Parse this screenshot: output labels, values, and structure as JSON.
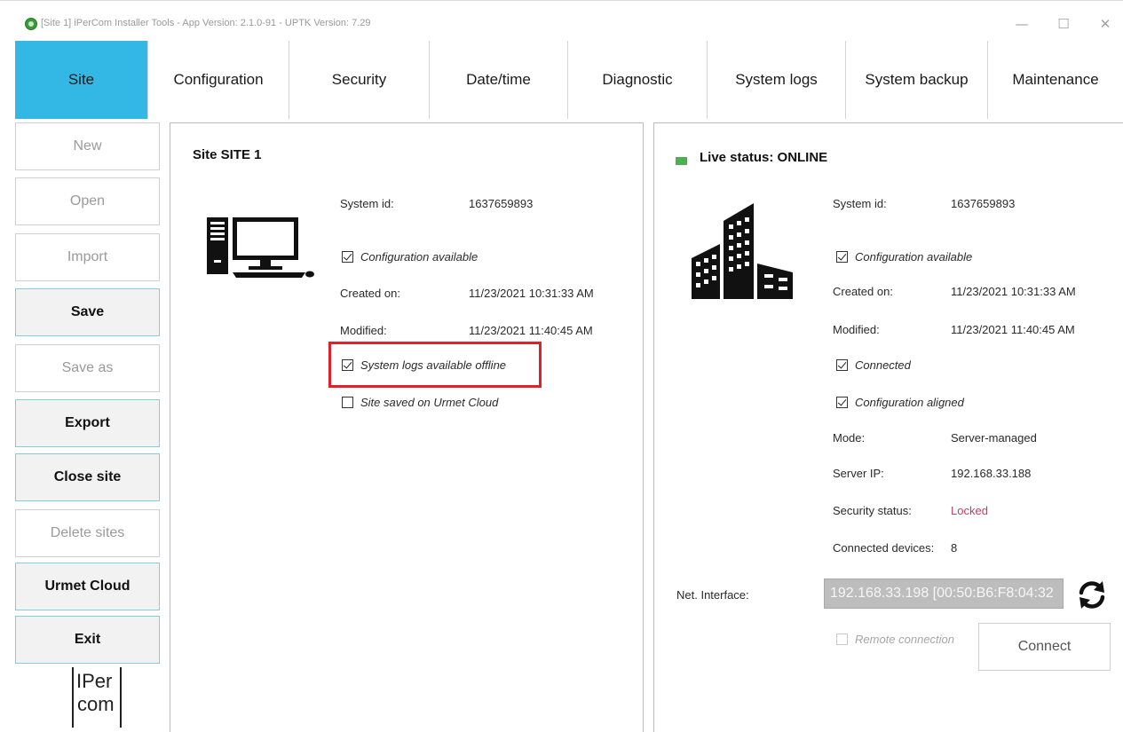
{
  "window": {
    "title": "[Site 1] iPerCom Installer Tools - App Version: 2.1.0-91 - UPTK Version: 7.29",
    "controls": {
      "minimize": "—",
      "maximize": "☐",
      "close": "✕"
    }
  },
  "tabs": [
    {
      "label": "Site",
      "active": true
    },
    {
      "label": "Configuration",
      "active": false
    },
    {
      "label": "Security",
      "active": false
    },
    {
      "label": "Date/time",
      "active": false
    },
    {
      "label": "Diagnostic",
      "active": false
    },
    {
      "label": "System logs",
      "active": false
    },
    {
      "label": "System backup",
      "active": false
    },
    {
      "label": "Maintenance",
      "active": false
    }
  ],
  "sidebar": {
    "buttons": [
      {
        "label": "New",
        "enabled": false
      },
      {
        "label": "Open",
        "enabled": false
      },
      {
        "label": "Import",
        "enabled": false
      },
      {
        "label": "Save",
        "enabled": true
      },
      {
        "label": "Save as",
        "enabled": false
      },
      {
        "label": "Export",
        "enabled": true
      },
      {
        "label": "Close site",
        "enabled": true
      },
      {
        "label": "Delete sites",
        "enabled": false
      },
      {
        "label": "Urmet Cloud",
        "enabled": true
      },
      {
        "label": "Exit",
        "enabled": true
      }
    ],
    "logo": {
      "line1": "IPer",
      "line2": "com"
    }
  },
  "site_panel": {
    "title": "Site SITE 1",
    "icon": "desktop-computer-icon",
    "system_id_label": "System id:",
    "system_id_value": "1637659893",
    "config_available": "Configuration available",
    "created_label": "Created on:",
    "created_value": "11/23/2021 10:31:33 AM",
    "modified_label": "Modified:",
    "modified_value": "11/23/2021 11:40:45 AM",
    "logs_offline": "System logs available offline",
    "saved_cloud": "Site saved on Urmet Cloud",
    "highlight_color": "#e0202a"
  },
  "live_panel": {
    "title": "Live status: ONLINE",
    "status_color": "#4caf50",
    "icon": "office-building-icon",
    "system_id_label": "System id:",
    "system_id_value": "1637659893",
    "config_available": "Configuration available",
    "created_label": "Created on:",
    "created_value": "11/23/2021 10:31:33 AM",
    "modified_label": "Modified:",
    "modified_value": "11/23/2021 11:40:45 AM",
    "connected": "Connected",
    "config_aligned": "Configuration aligned",
    "mode_label": "Mode:",
    "mode_value": "Server-managed",
    "server_ip_label": "Server IP:",
    "server_ip_value": "192.168.33.188",
    "security_label": "Security status:",
    "security_value": "Locked",
    "devices_label": "Connected devices:",
    "devices_value": "8",
    "net_interface_label": "Net. Interface:",
    "net_interface_value": "192.168.33.198 [00:50:B6:F8:04:32",
    "remote_connection": "Remote connection",
    "connect_label": "Connect"
  },
  "colors": {
    "accent": "#33b8e6",
    "locked": "#c0405a"
  }
}
